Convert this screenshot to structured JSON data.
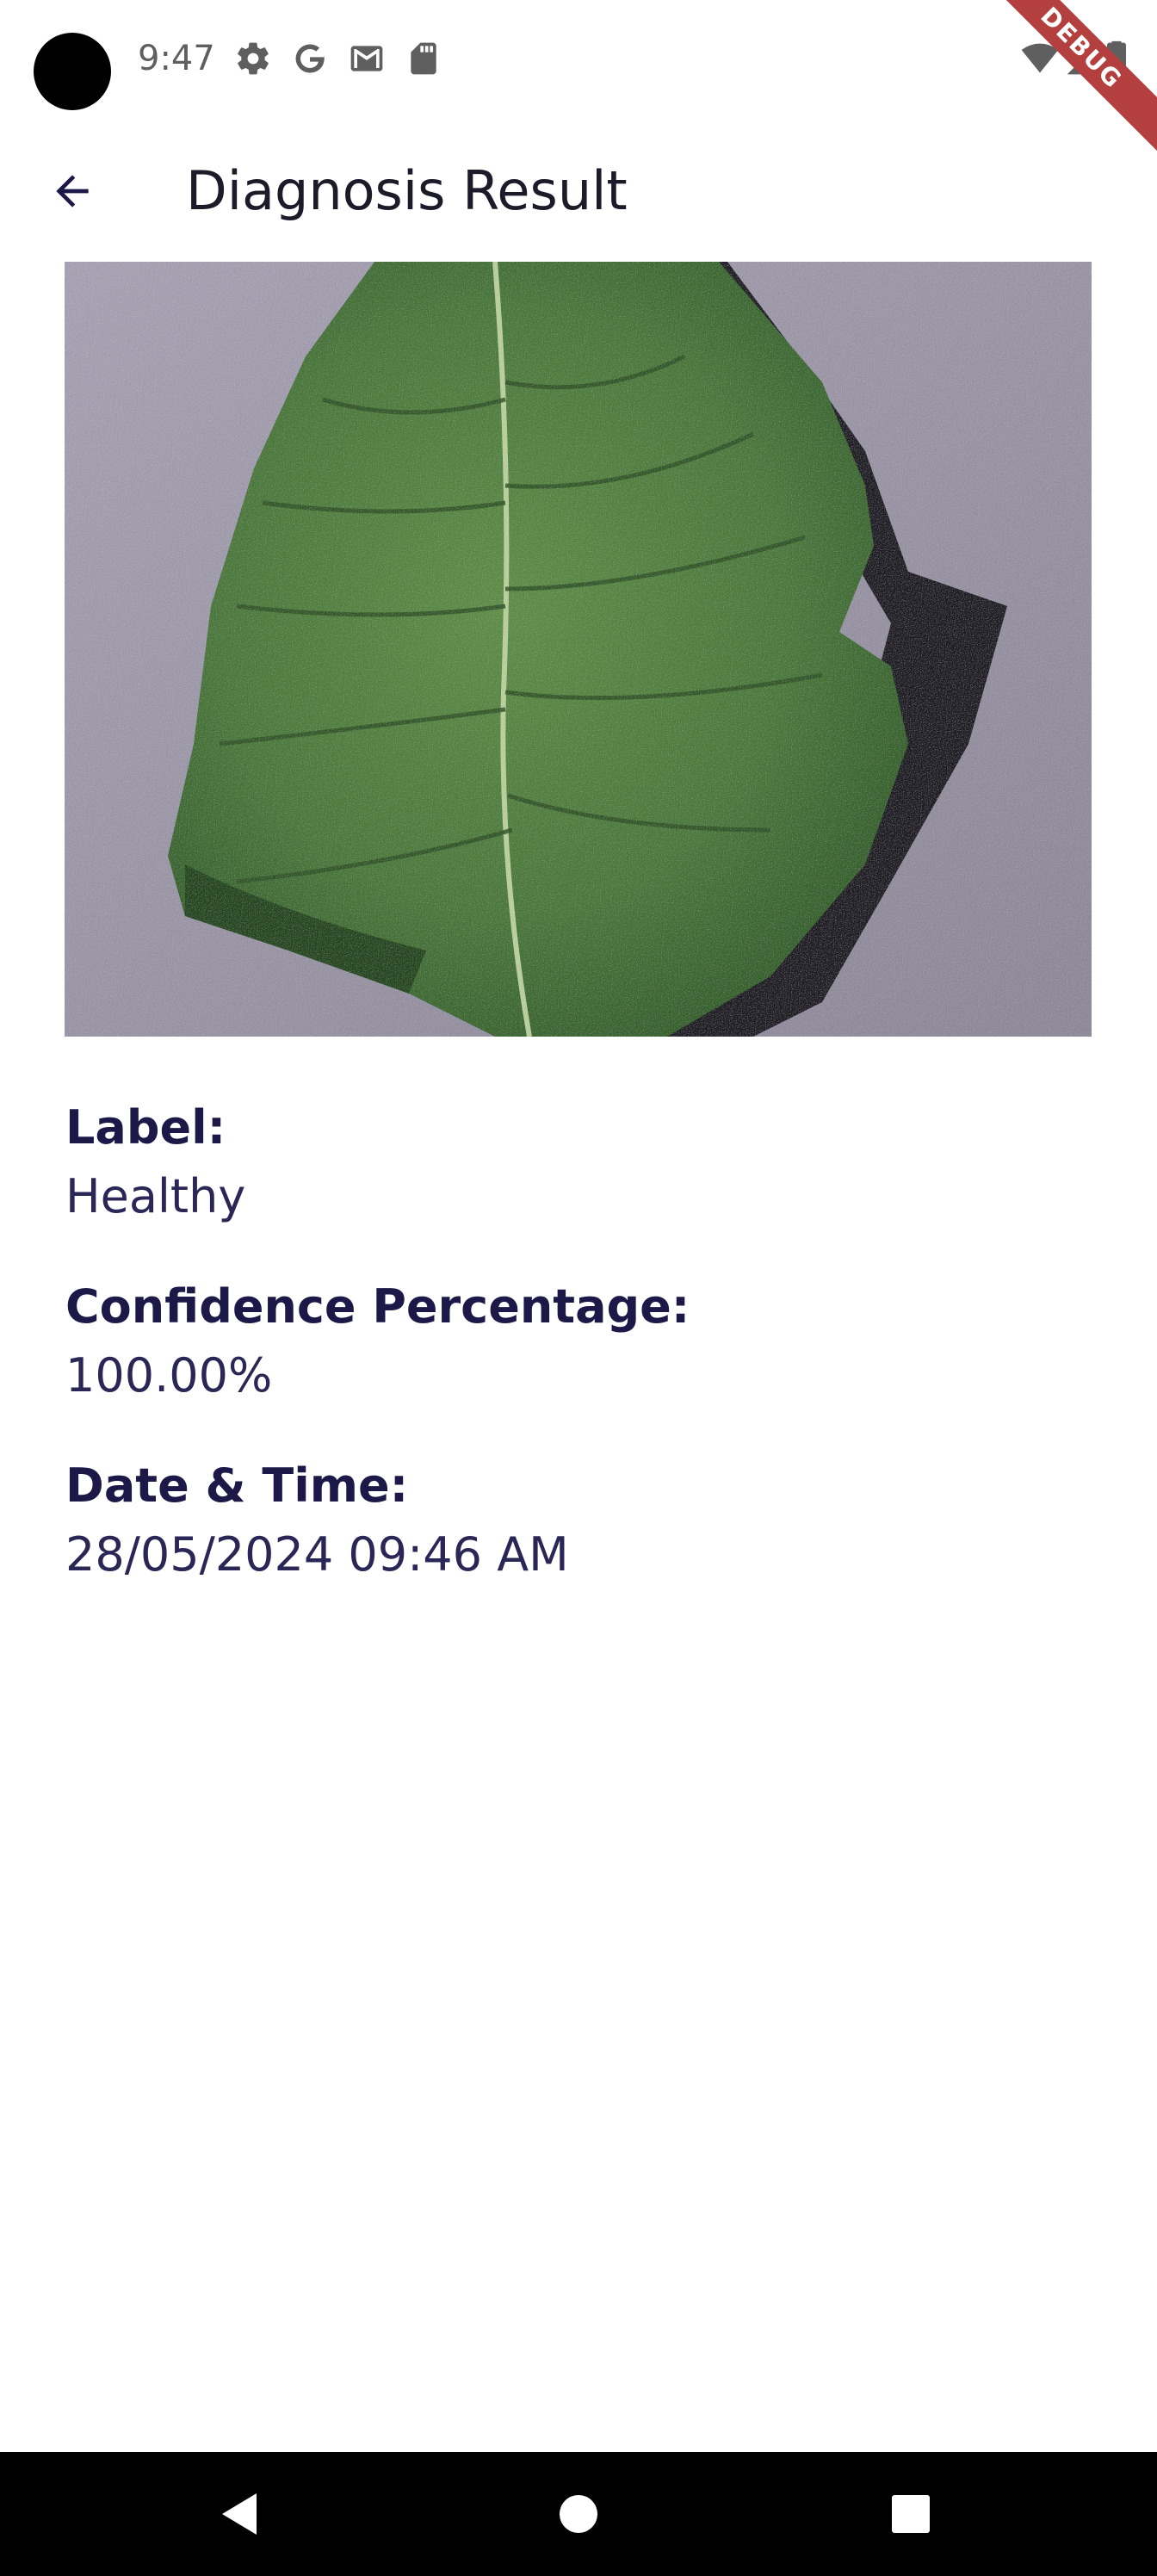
{
  "status_bar": {
    "time": "9:47",
    "icons": [
      "settings-gear-icon",
      "google-g-icon",
      "gmail-icon",
      "sd-card-icon",
      "wifi-icon",
      "signal-icon",
      "battery-icon"
    ],
    "debug_banner": "DEBUG"
  },
  "app_bar": {
    "title": "Diagnosis Result",
    "back_icon": "arrow-back-icon"
  },
  "result": {
    "label_heading": "Label:",
    "label_value": "Healthy",
    "confidence_heading": "Confidence Percentage:",
    "confidence_value": "100.00%",
    "datetime_heading": "Date & Time:",
    "datetime_value": "28/05/2024 09:46 AM"
  },
  "nav_bar": {
    "back_icon": "nav-back-icon",
    "home_icon": "nav-home-icon",
    "recents_icon": "nav-recents-icon"
  },
  "colors": {
    "text_primary": "#1c1848",
    "debug_ribbon": "#b3403f",
    "nav_background": "#000000"
  }
}
